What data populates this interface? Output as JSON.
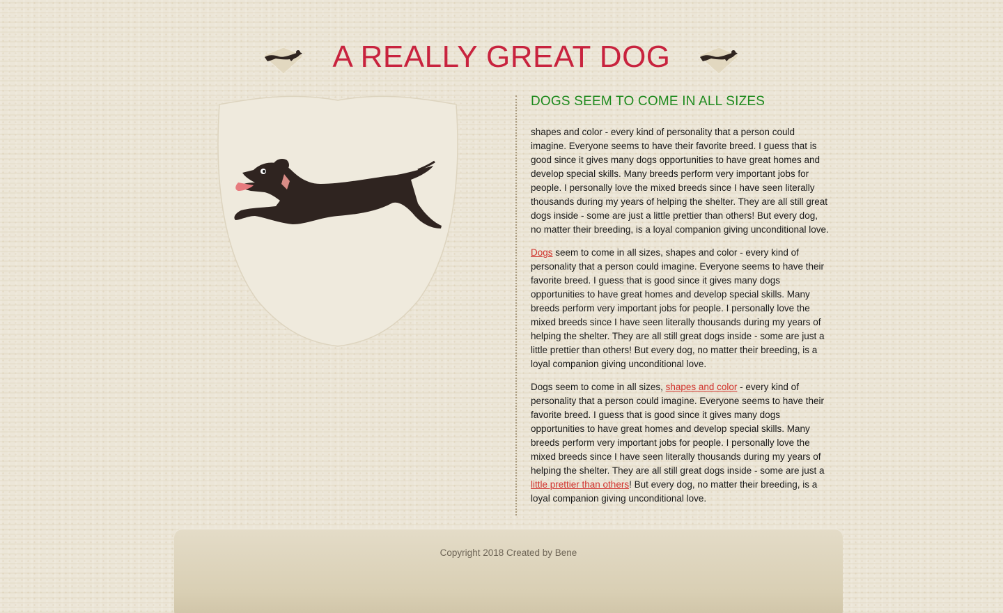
{
  "site": {
    "title": "A REALLY GREAT DOG"
  },
  "article": {
    "heading": "DOGS SEEM TO COME IN ALL SIZES",
    "p1": "shapes and color - every kind of personality that a person could imagine. Everyone seems to have their favorite breed. I guess that is good since it gives many dogs opportunities to have great homes and develop special skills. Many breeds perform very important jobs for people. I personally love the mixed breeds since I have seen literally thousands during my years of helping the shelter. They are all still great dogs inside - some are just a little prettier than others! But every dog, no matter their breeding, is a loyal companion giving unconditional love.",
    "p2_link": "Dogs",
    "p2_rest": " seem to come in all sizes, shapes and color - every kind of personality that a person could imagine. Everyone seems to have their favorite breed. I guess that is good since it gives many dogs opportunities to have great homes and develop special skills. Many breeds perform very important jobs for people. I personally love the mixed breeds since I have seen literally thousands during my years of helping the shelter. They are all still great dogs inside - some are just a little prettier than others! But every dog, no matter their breeding, is a loyal companion giving unconditional love.",
    "p3_start": "Dogs seem to come in all sizes, ",
    "p3_link1": "shapes and color",
    "p3_middle": " - every kind of personality that a person could imagine. Everyone seems to have their favorite breed. I guess that is good since it gives many dogs opportunities to have great homes and develop special skills. Many breeds perform very important jobs for people. I personally love the mixed breeds since I have seen literally thousands during my years of helping the shelter. They are all still great dogs inside - some are just a ",
    "p3_link2": "little prettier than others",
    "p3_end": "! But every dog, no matter their breeding, is a loyal companion giving unconditional love."
  },
  "footer": {
    "copyright": "Copyright 2018 Created by Bene"
  },
  "icons": {
    "header_left": "running-dog-icon",
    "header_right": "running-dog-icon",
    "hero": "running-dog-illustration"
  },
  "colors": {
    "title": "#c8233e",
    "heading": "#1e8a1e",
    "link": "#d0322c",
    "dog": "#2f2420"
  }
}
